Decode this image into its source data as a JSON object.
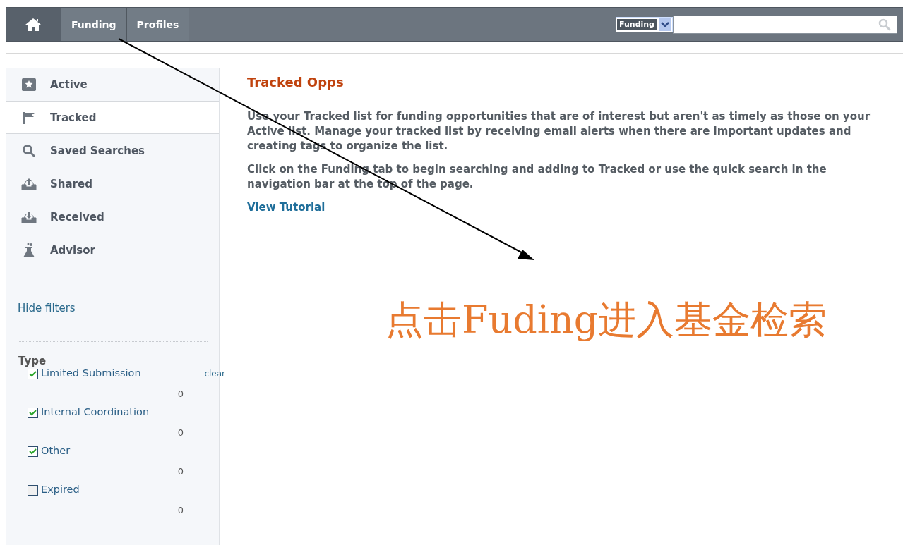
{
  "nav": {
    "tabs": [
      {
        "kind": "home"
      },
      {
        "kind": "text",
        "label": "Funding"
      },
      {
        "kind": "text",
        "label": "Profiles"
      }
    ],
    "search": {
      "scope": "Funding"
    }
  },
  "sidebar": {
    "items": [
      {
        "kind": "star",
        "label": "Active",
        "selected": false
      },
      {
        "kind": "flag",
        "label": "Tracked",
        "selected": true
      },
      {
        "kind": "search",
        "label": "Saved Searches",
        "selected": false
      },
      {
        "kind": "upload",
        "label": "Shared",
        "selected": false
      },
      {
        "kind": "download",
        "label": "Received",
        "selected": false
      },
      {
        "kind": "flask",
        "label": "Advisor",
        "selected": false
      }
    ],
    "hide_filters": "Hide filters",
    "filter": {
      "title": "Type",
      "clear": "clear",
      "options": [
        {
          "label": "Limited Submission",
          "count": "0",
          "checked": true
        },
        {
          "label": "Internal Coordination",
          "count": "0",
          "checked": true
        },
        {
          "label": "Other",
          "count": "0",
          "checked": true
        },
        {
          "label": "Expired",
          "count": "0",
          "checked": false
        }
      ]
    }
  },
  "main": {
    "title": "Tracked Opps",
    "paragraphs": [
      "Use your Tracked list for funding opportunities that are of interest but aren't as timely as those on your Active list. Manage your tracked list by receiving email alerts when there are important updates and creating tags to organize the list.",
      "Click on the Funding tab to begin searching and adding to Tracked or use the quick search in the navigation bar at the top of the page."
    ],
    "link": "View Tutorial"
  },
  "annotation": {
    "text": "点击Fuding进入基金检索"
  }
}
